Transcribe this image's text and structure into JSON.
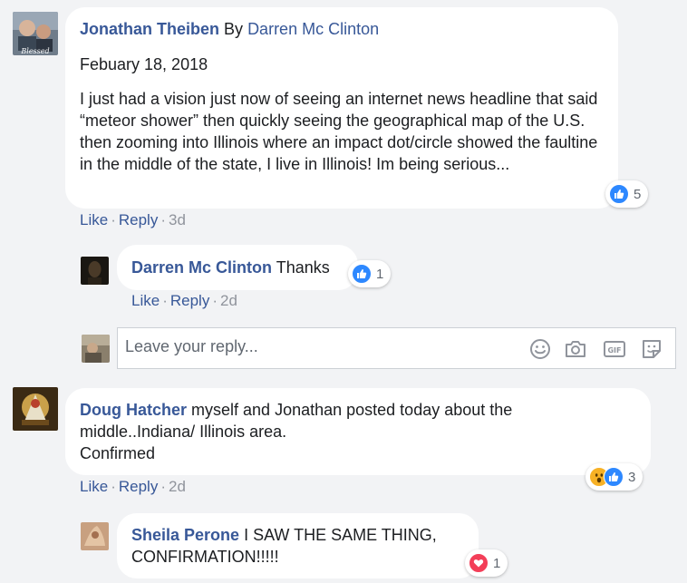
{
  "comments": [
    {
      "author": "Jonathan Theiben",
      "by_text": "By",
      "by_author": "Darren Mc Clinton",
      "date": "Febuary 18, 2018",
      "text": "I just had a vision just now of seeing an internet news headline that said “meteor shower” then quickly seeing the geographical map of the U.S. then zooming into Illinois where an impact dot/circle showed the faultine in the middle of the state, I live in Illinois! Im being serious...",
      "reaction_count": "5",
      "like_label": "Like",
      "reply_label": "Reply",
      "time": "3d",
      "replies": [
        {
          "author": "Darren Mc Clinton",
          "text": "Thanks",
          "reaction_count": "1",
          "like_label": "Like",
          "reply_label": "Reply",
          "time": "2d"
        }
      ]
    },
    {
      "author": "Doug Hatcher",
      "text_line1": "myself and Jonathan posted today about the",
      "text_line2": "middle..Indiana/ Illinois area.",
      "text_line3": "Confirmed",
      "reaction_count": "3",
      "like_label": "Like",
      "reply_label": "Reply",
      "time": "2d",
      "replies": [
        {
          "author": "Sheila Perone",
          "text_line1": "I SAW THE SAME THING,",
          "text_line2": "CONFIRMATION!!!!!",
          "reaction_count": "1"
        }
      ]
    }
  ],
  "reply_box": {
    "placeholder": "Leave your reply..."
  },
  "avatar_caption": "Blessed",
  "icons": {
    "like": "like-icon",
    "love": "love-icon",
    "wow": "wow-icon",
    "emoji": "emoji-icon",
    "camera": "camera-icon",
    "gif": "gif-icon",
    "sticker": "sticker-icon"
  },
  "colors": {
    "link": "#385898",
    "meta": "#90949c",
    "bubble": "#ffffff",
    "background": "#f2f3f5",
    "like": "#2d88ff",
    "love": "#f33e58"
  }
}
